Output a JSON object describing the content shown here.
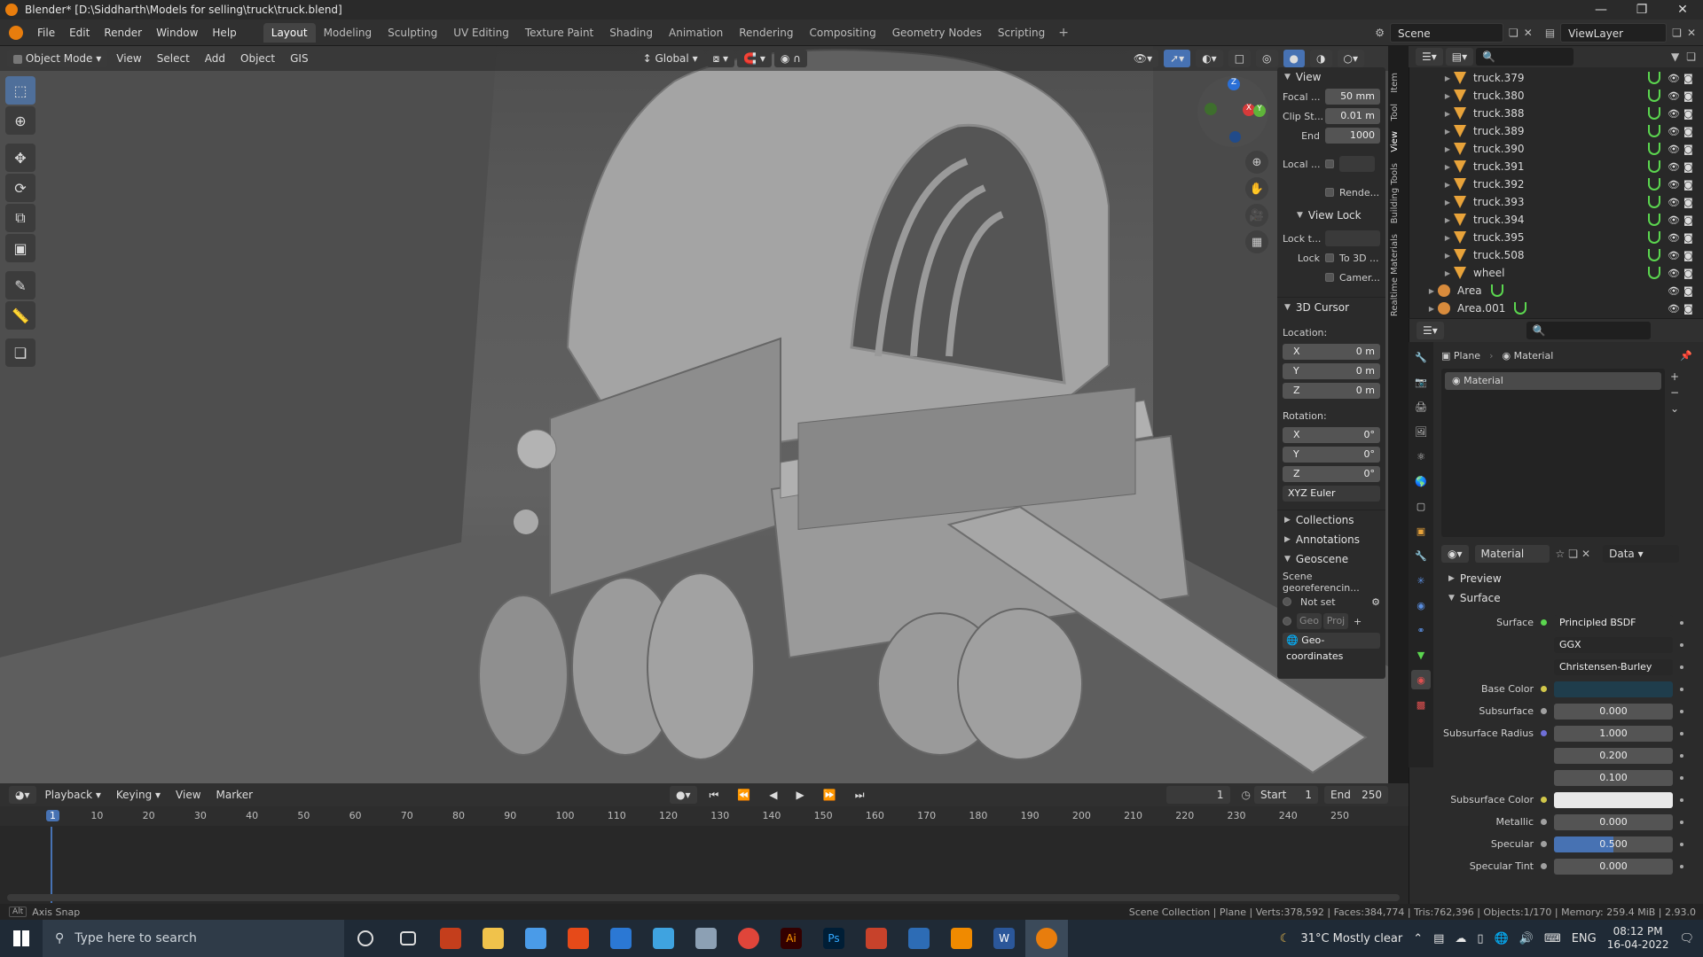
{
  "window_title": "Blender* [D:\\Siddharth\\Models for selling\\truck\\truck.blend]",
  "menus": [
    "File",
    "Edit",
    "Render",
    "Window",
    "Help"
  ],
  "workspaces": [
    "Layout",
    "Modeling",
    "Sculpting",
    "UV Editing",
    "Texture Paint",
    "Shading",
    "Animation",
    "Rendering",
    "Compositing",
    "Geometry Nodes",
    "Scripting"
  ],
  "active_workspace": "Layout",
  "scene_name": "Scene",
  "view_layer": "ViewLayer",
  "viewport_header": {
    "mode": "Object Mode",
    "menus": [
      "View",
      "Select",
      "Add",
      "Object",
      "GIS"
    ],
    "transform_orientation": "Global"
  },
  "npanel": {
    "view": {
      "title": "View",
      "focal_label": "Focal ...",
      "focal_value": "50 mm",
      "clip_start_label": "Clip St...",
      "clip_start_value": "0.01 m",
      "end_label": "End",
      "end_value": "1000",
      "local_label": "Local ...",
      "render_label": "Rende...",
      "view_lock_title": "View Lock",
      "lock_to_label": "Lock t...",
      "lock_label": "Lock",
      "to3d_label": "To 3D ...",
      "camera_label": "Camer..."
    },
    "cursor": {
      "title": "3D Cursor",
      "location_label": "Location:",
      "x": "0 m",
      "y": "0 m",
      "z": "0 m",
      "rotation_label": "Rotation:",
      "rx": "0°",
      "ry": "0°",
      "rz": "0°",
      "rotation_mode": "XYZ Euler"
    },
    "collections": "Collections",
    "annotations": "Annotations",
    "geoscene": {
      "title": "Geoscene",
      "desc": "Scene georeferencin...",
      "not_set": "Not set",
      "geo": "Geo",
      "proj": "Proj",
      "geocoords": "Geo-coordinates"
    }
  },
  "side_tabs": [
    "Item",
    "Tool",
    "View",
    "Building Tools",
    "Realtime Materials"
  ],
  "outliner": {
    "items": [
      {
        "name": "truck.379",
        "type": "mesh"
      },
      {
        "name": "truck.380",
        "type": "mesh"
      },
      {
        "name": "truck.388",
        "type": "mesh"
      },
      {
        "name": "truck.389",
        "type": "mesh"
      },
      {
        "name": "truck.390",
        "type": "mesh"
      },
      {
        "name": "truck.391",
        "type": "mesh"
      },
      {
        "name": "truck.392",
        "type": "mesh"
      },
      {
        "name": "truck.393",
        "type": "mesh"
      },
      {
        "name": "truck.394",
        "type": "mesh"
      },
      {
        "name": "truck.395",
        "type": "mesh"
      },
      {
        "name": "truck.508",
        "type": "mesh"
      },
      {
        "name": "wheel",
        "type": "mesh"
      },
      {
        "name": "Area",
        "type": "light"
      },
      {
        "name": "Area.001",
        "type": "light"
      }
    ]
  },
  "properties": {
    "breadcrumb_object": "Plane",
    "breadcrumb_material": "Material",
    "slot_name": "Material",
    "material_name": "Material",
    "link_mode": "Data",
    "preview": "Preview",
    "surface_section": "Surface",
    "rows": [
      {
        "label": "Surface",
        "value": "Principled BSDF",
        "dot": "#5bd64f",
        "kind": "node"
      },
      {
        "label": "",
        "value": "GGX",
        "dot": "",
        "kind": "dropdown"
      },
      {
        "label": "",
        "value": "Christensen-Burley",
        "dot": "",
        "kind": "dropdown"
      },
      {
        "label": "Base Color",
        "value": "",
        "dot": "#d1c74a",
        "kind": "color",
        "color": "#1f3d4c"
      },
      {
        "label": "Subsurface",
        "value": "0.000",
        "dot": "#a0a0a0",
        "kind": "number"
      },
      {
        "label": "Subsurface Radius",
        "value": "1.000",
        "dot": "#6f6fd8",
        "kind": "number"
      },
      {
        "label": "",
        "value": "0.200",
        "dot": "",
        "kind": "number"
      },
      {
        "label": "",
        "value": "0.100",
        "dot": "",
        "kind": "number"
      },
      {
        "label": "Subsurface Color",
        "value": "",
        "dot": "#d1c74a",
        "kind": "color",
        "color": "#e9e9e9"
      },
      {
        "label": "Metallic",
        "value": "0.000",
        "dot": "#a0a0a0",
        "kind": "number"
      },
      {
        "label": "Specular",
        "value": "0.500",
        "dot": "#a0a0a0",
        "kind": "slider",
        "fill": 0.5
      },
      {
        "label": "Specular Tint",
        "value": "0.000",
        "dot": "#a0a0a0",
        "kind": "number"
      }
    ]
  },
  "timeline": {
    "menus": [
      "Playback",
      "Keying",
      "View",
      "Marker"
    ],
    "current_frame": "1",
    "start_label": "Start",
    "start": "1",
    "end_label": "End",
    "end": "250",
    "ticks": [
      "1",
      "10",
      "20",
      "30",
      "40",
      "50",
      "60",
      "70",
      "80",
      "90",
      "100",
      "110",
      "120",
      "130",
      "140",
      "150",
      "160",
      "170",
      "180",
      "190",
      "200",
      "210",
      "220",
      "230",
      "240",
      "250"
    ]
  },
  "status": {
    "left": "Axis Snap",
    "right": "Scene Collection | Plane | Verts:378,592 | Faces:384,774 | Tris:762,396 | Objects:1/170 | Memory: 259.4 MiB | 2.93.0"
  },
  "taskbar": {
    "search_placeholder": "Type here to search",
    "weather": "31°C  Mostly clear",
    "lang": "ENG",
    "time": "08:12 PM",
    "date": "16-04-2022"
  },
  "colors": {
    "accent": "#4772b3",
    "blender_orange": "#e87d0d",
    "panel_bg": "#2b2b2b"
  }
}
